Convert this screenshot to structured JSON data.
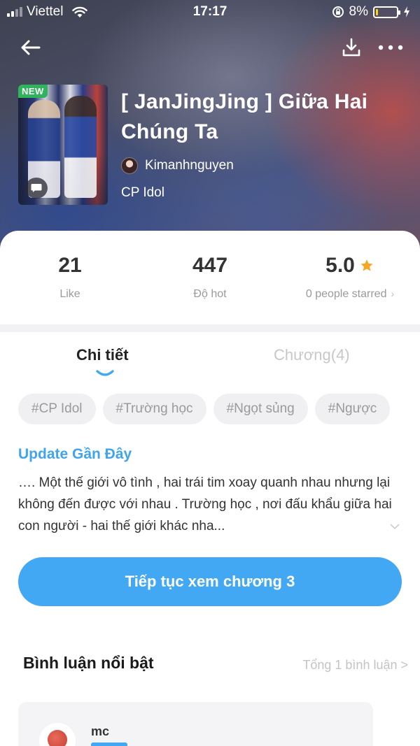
{
  "status_bar": {
    "carrier": "Viettel",
    "time": "17:17",
    "battery": "8%",
    "battery_level_fraction": 0.08
  },
  "book": {
    "badge": "NEW",
    "title": "[ JanJingJing ] Giữa Hai Chúng Ta",
    "author": "Kimanhnguyen",
    "category": "CP Idol"
  },
  "stats": {
    "likes": "21",
    "likes_label": "Like",
    "hot": "447",
    "hot_label": "Độ hot",
    "rating": "5.0",
    "rating_label": "0 people starred"
  },
  "tabs": {
    "detail": "Chi tiết",
    "chapters": "Chương(4)"
  },
  "tags": [
    "#CP Idol",
    "#Trường học",
    "#Ngọt sủng",
    "#Ngược"
  ],
  "update": {
    "heading": "Update Gần Đây",
    "synopsis": "….  Một thế giới vô tình , hai trái tim xoay quanh nhau nhưng lại không đến được với nhau . Trường học , nơi đấu khẩu giữa hai con người - hai thế giới khác nha..."
  },
  "continue_button": "Tiếp tục xem chương 3",
  "comments": {
    "heading": "Bình luận nổi bật",
    "total": "Tổng 1 bình luận >",
    "items": [
      {
        "name": "mc"
      }
    ]
  },
  "colors": {
    "accent": "#43a8f3",
    "new_badge": "#2fb35d",
    "star": "#f5a623"
  },
  "icons": {
    "back": "arrow-left-icon",
    "download": "download-icon",
    "more": "more-horizontal-icon",
    "star": "star-icon",
    "chat": "chat-bubble-icon",
    "expand": "chevron-down-icon"
  }
}
